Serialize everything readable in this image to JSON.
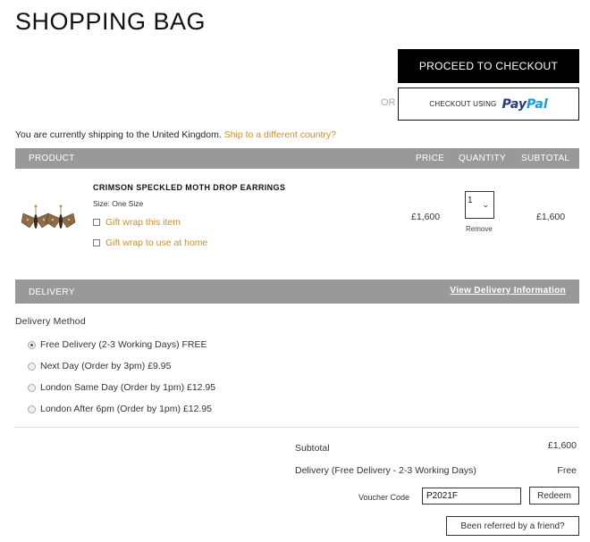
{
  "page": {
    "title": "SHOPPING BAG"
  },
  "checkout": {
    "proceed_label": "PROCEED TO CHECKOUT",
    "or_label": "OR",
    "paypal_label": "CHECKOUT USING",
    "paypal_logo_part1": "Pay",
    "paypal_logo_part2": "Pal"
  },
  "shipping": {
    "text": "You are currently shipping to the United Kingdom.",
    "link": "Ship to a different country?"
  },
  "table": {
    "headers": {
      "product": "PRODUCT",
      "price": "PRICE",
      "quantity": "QUANTITY",
      "subtotal": "SUBTOTAL"
    }
  },
  "item": {
    "name": "CRIMSON SPECKLED MOTH DROP EARRINGS",
    "size": "Size: One Size",
    "gift_wrap": "Gift wrap this item",
    "gift_wrap_home": "Gift wrap to use at home",
    "price": "£1,600",
    "quantity": "1",
    "remove_label": "Remove",
    "subtotal": "£1,600"
  },
  "delivery": {
    "header": "DELIVERY",
    "info_link": "View Delivery Information",
    "method_label": "Delivery Method",
    "options": [
      {
        "label": "Free Delivery (2-3 Working Days) FREE",
        "selected": true
      },
      {
        "label": "Next Day (Order by 3pm) £9.95",
        "selected": false
      },
      {
        "label": "London Same Day (Order by 1pm) £12.95",
        "selected": false
      },
      {
        "label": "London After 6pm (Order by 1pm) £12.95",
        "selected": false
      }
    ]
  },
  "summary": {
    "subtotal_label": "Subtotal",
    "subtotal_value": "£1,600",
    "delivery_label": "Delivery (Free Delivery - 2-3 Working Days)",
    "delivery_value": "Free",
    "voucher_label": "Voucher Code",
    "voucher_value": "P2021F",
    "redeem_label": "Redeem",
    "referred_label": "Been referred by a friend?"
  },
  "colors": {
    "accent": "#c8902d",
    "header_bg": "#999999",
    "button_bg": "#000000"
  }
}
